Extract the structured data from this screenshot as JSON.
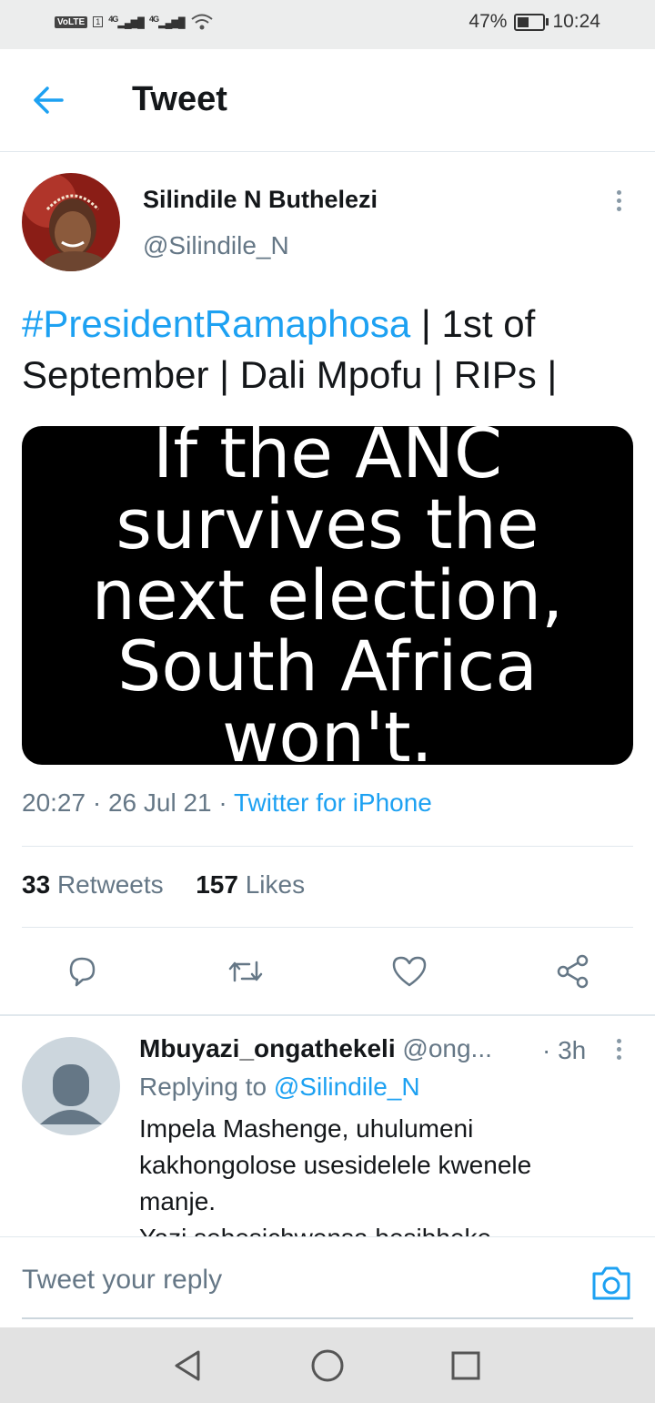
{
  "status_bar": {
    "volte": "VoLTE",
    "sim": "1",
    "net1": "4G",
    "net2": "4G",
    "battery_percent_text": "47%",
    "battery_level": 0.47,
    "time": "10:24"
  },
  "header": {
    "title": "Tweet"
  },
  "tweet": {
    "author_name": "Silindile N Buthelezi",
    "author_handle": "@Silindile_N",
    "hashtag": "#PresidentRamaphosa",
    "text_rest": " | 1st of September | Dali Mpofu | RIPs |",
    "image_text": "If the ANC survives the next election, South Africa won't.",
    "time": "20:27",
    "date": "26 Jul 21",
    "source": "Twitter for iPhone",
    "retweets_count": "33",
    "retweets_label": "Retweets",
    "likes_count": "157",
    "likes_label": "Likes"
  },
  "reply": {
    "author_name": "Mbuyazi_ongathekeli",
    "author_handle": "@ong...",
    "age": "3h",
    "replying_prefix": "Replying to",
    "replying_to": "@Silindile_N",
    "text_line1": "Impela Mashenge, uhulumeni kakhongolose usesidelele kwenele manje.",
    "text_line2": "Yazi sebesichwensa besibheke"
  },
  "composer": {
    "placeholder": "Tweet your reply"
  },
  "colors": {
    "accent": "#1da1f2",
    "secondary_text": "#657786",
    "divider": "#e1e8ed"
  },
  "icons": [
    "back-arrow-icon",
    "more-icon",
    "reply-icon",
    "retweet-icon",
    "like-icon",
    "share-icon",
    "camera-icon",
    "nav-back-icon",
    "nav-home-icon",
    "nav-recents-icon"
  ]
}
